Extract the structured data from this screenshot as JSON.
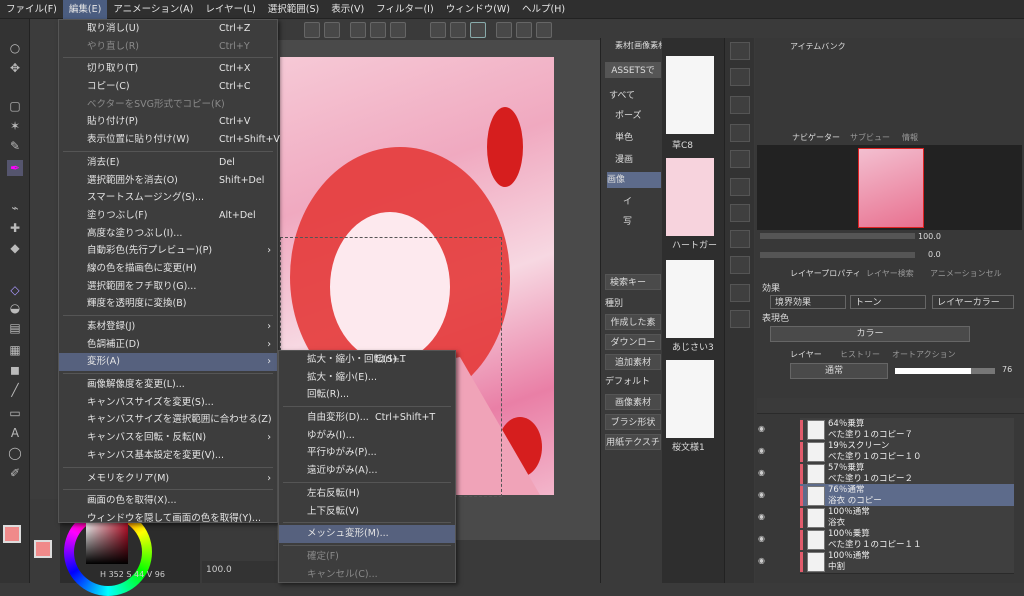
{
  "menubar": [
    "ファイル(F)",
    "編集(E)",
    "アニメーション(A)",
    "レイヤー(L)",
    "選択範囲(S)",
    "表示(V)",
    "フィルター(I)",
    "ウィンドウ(W)",
    "ヘルプ(H)"
  ],
  "edit_menu": [
    {
      "label": "取り消し(U)",
      "shortcut": "Ctrl+Z"
    },
    {
      "label": "やり直し(R)",
      "shortcut": "Ctrl+Y",
      "disabled": true
    },
    {
      "sep": true
    },
    {
      "label": "切り取り(T)",
      "shortcut": "Ctrl+X"
    },
    {
      "label": "コピー(C)",
      "shortcut": "Ctrl+C"
    },
    {
      "label": "ベクターをSVG形式でコピー(K)",
      "disabled": true
    },
    {
      "label": "貼り付け(P)",
      "shortcut": "Ctrl+V"
    },
    {
      "label": "表示位置に貼り付け(W)",
      "shortcut": "Ctrl+Shift+V"
    },
    {
      "sep": true
    },
    {
      "label": "消去(E)",
      "shortcut": "Del"
    },
    {
      "label": "選択範囲外を消去(O)",
      "shortcut": "Shift+Del"
    },
    {
      "label": "スマートスムージング(S)..."
    },
    {
      "label": "塗りつぶし(F)",
      "shortcut": "Alt+Del"
    },
    {
      "label": "高度な塗りつぶし(I)..."
    },
    {
      "label": "自動彩色(先行プレビュー)(P)",
      "arrow": true
    },
    {
      "label": "線の色を描画色に変更(H)"
    },
    {
      "label": "選択範囲をフチ取り(G)..."
    },
    {
      "label": "輝度を透明度に変換(B)"
    },
    {
      "sep": true
    },
    {
      "label": "素材登録(J)",
      "arrow": true
    },
    {
      "label": "色調補正(D)",
      "arrow": true
    },
    {
      "label": "変形(A)",
      "arrow": true,
      "highlight": true
    },
    {
      "sep": true
    },
    {
      "label": "画像解像度を変更(L)..."
    },
    {
      "label": "キャンバスサイズを変更(S)..."
    },
    {
      "label": "キャンバスサイズを選択範囲に合わせる(Z)"
    },
    {
      "label": "キャンバスを回転・反転(N)",
      "arrow": true
    },
    {
      "label": "キャンバス基本設定を変更(V)..."
    },
    {
      "sep": true
    },
    {
      "label": "メモリをクリア(M)",
      "arrow": true
    },
    {
      "sep": true
    },
    {
      "label": "画面の色を取得(X)..."
    },
    {
      "label": "ウィンドウを隠して画面の色を取得(Y)..."
    }
  ],
  "transform_menu": [
    {
      "label": "拡大・縮小・回転(S)...",
      "shortcut": "Ctrl+T"
    },
    {
      "label": "拡大・縮小(E)..."
    },
    {
      "label": "回転(R)..."
    },
    {
      "sep": true
    },
    {
      "label": "自由変形(D)...",
      "shortcut": "Ctrl+Shift+T"
    },
    {
      "label": "ゆがみ(I)..."
    },
    {
      "label": "平行ゆがみ(P)..."
    },
    {
      "label": "遠近ゆがみ(A)..."
    },
    {
      "sep": true
    },
    {
      "label": "左右反転(H)"
    },
    {
      "label": "上下反転(V)"
    },
    {
      "sep": true
    },
    {
      "label": "メッシュ変形(M)...",
      "highlight": true
    },
    {
      "sep": true
    },
    {
      "label": "確定(F)",
      "disabled": true
    },
    {
      "label": "キャンセル(C)...",
      "disabled": true
    }
  ],
  "material_panel": {
    "tab": "素材[画像素材]",
    "assets": "ASSETSで",
    "tree": [
      "すべて",
      "ポーズ",
      "単色",
      "漫画",
      "画像",
      "イ",
      "写"
    ],
    "search_placeholder": "検索キー",
    "category_label": "種別",
    "buttons": [
      "作成した素",
      "ダウンロー",
      "追加素材"
    ],
    "default_label": "デフォルト",
    "buttons2": [
      "画像素材",
      "ブラシ形状",
      "用紙テクスチ"
    ]
  },
  "thumbs": [
    "草C8",
    "ハートガー",
    "あじさい3",
    "桜文様1"
  ],
  "item_bank": "アイテムバンク",
  "navigator": {
    "tabs": [
      "ナビゲーター",
      "サブビュー",
      "情報"
    ],
    "zoom": "100.0",
    "angle": "0.0"
  },
  "layer_property": {
    "tabs": [
      "レイヤープロパティ",
      "レイヤー検索",
      "アニメーションセル"
    ],
    "effect_label": "効果",
    "effects": [
      "境界効果",
      "トーン",
      "レイヤーカラー"
    ],
    "expression_label": "表現色",
    "expression_value": "カラー"
  },
  "layer_panel": {
    "tabs": [
      "レイヤー",
      "ヒストリー",
      "オートアクション"
    ],
    "blend": "通常",
    "opacity": "76"
  },
  "layers": [
    {
      "line1": "64％乗算",
      "line2": "べた塗り１のコピー７"
    },
    {
      "line1": "19％スクリーン",
      "line2": "べた塗り１のコピー１０"
    },
    {
      "line1": "57％乗算",
      "line2": "べた塗り１のコピー２"
    },
    {
      "line1": "76％通常",
      "line2": "浴衣 のコピー",
      "selected": true
    },
    {
      "line1": "100％通常",
      "line2": "浴衣"
    },
    {
      "line1": "100％乗算",
      "line2": "べた塗り１のコピー１１"
    },
    {
      "line1": "100％通常",
      "line2": "中割"
    }
  ],
  "color": {
    "h": "352",
    "s": "44",
    "v": "96",
    "main": "#f08a8a"
  },
  "canvas_status": "100.0"
}
